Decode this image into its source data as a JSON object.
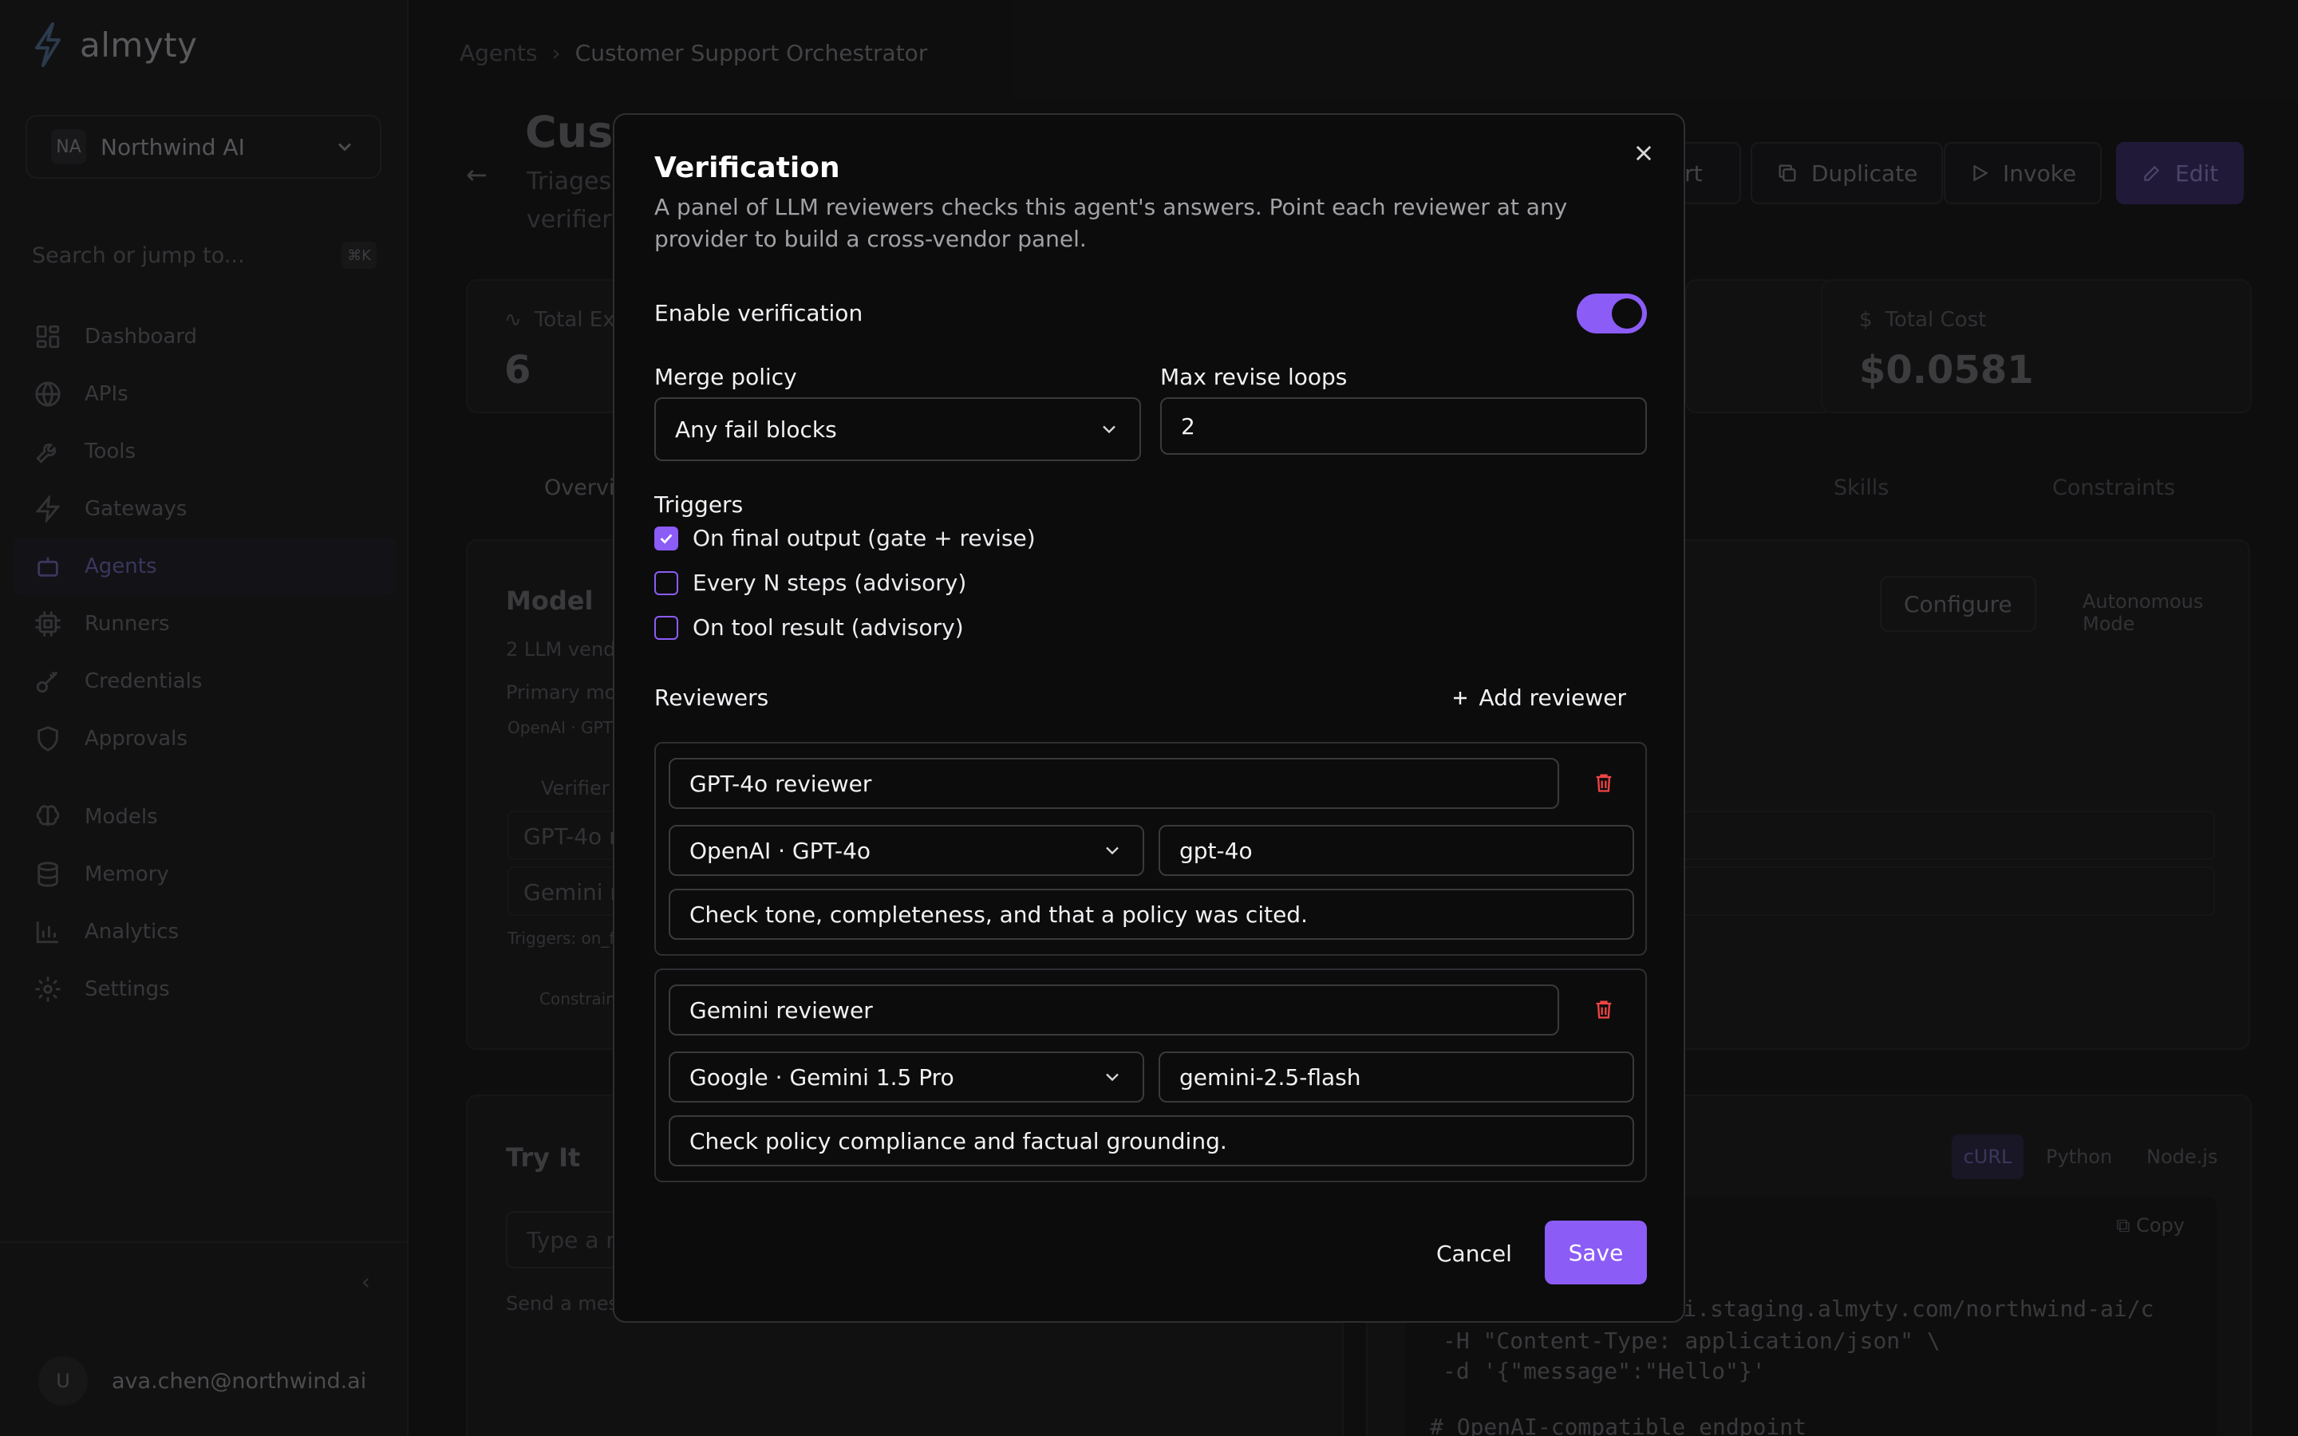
{
  "app": {
    "name": "almyty"
  },
  "sidebar": {
    "org_initials": "NA",
    "org_name": "Northwind AI",
    "search_placeholder": "Search or jump to...",
    "search_shortcut": "⌘K",
    "items": [
      {
        "label": "Dashboard",
        "icon": "grid-icon"
      },
      {
        "label": "APIs",
        "icon": "globe-icon"
      },
      {
        "label": "Tools",
        "icon": "wrench-icon"
      },
      {
        "label": "Gateways",
        "icon": "bolt-icon"
      },
      {
        "label": "Agents",
        "icon": "bot-icon"
      },
      {
        "label": "Runners",
        "icon": "cpu-icon"
      },
      {
        "label": "Credentials",
        "icon": "key-icon"
      },
      {
        "label": "Approvals",
        "icon": "shield-icon"
      }
    ],
    "items2": [
      {
        "label": "Models",
        "icon": "brain-icon"
      },
      {
        "label": "Memory",
        "icon": "database-icon"
      },
      {
        "label": "Analytics",
        "icon": "bar-chart-icon"
      },
      {
        "label": "Settings",
        "icon": "gear-icon"
      }
    ],
    "user_initial": "U",
    "user_email": "ava.chen@northwind.ai"
  },
  "main": {
    "breadcrumb_root": "Agents",
    "breadcrumb_current": "Customer Support Orchestrator",
    "title": "Cust",
    "desc_line1": "Triages",
    "desc_line2": "verifier",
    "btn_export": "ort",
    "btn_duplicate": "Duplicate",
    "btn_invoke": "Invoke",
    "btn_edit": "Edit",
    "stat1_label": "Total Ex",
    "stat1_value": "6",
    "stat2_label": "Total Cost",
    "stat2_value": "$0.0581",
    "tab_overview": "Overvi",
    "tab_skills": "Skills",
    "tab_constraints": "Constraints",
    "model_title": "Model",
    "model_sub": "2 LLM vendo",
    "primary_model": "Primary mod",
    "model_chip": "OpenAI · GPT",
    "verifier_label": "Verifier p",
    "verifier_row1": "GPT-4o re",
    "verifier_row2": "Gemini re",
    "triggers_note": "Triggers: on_fi",
    "constraints_chip": "Constrain",
    "configure": "Configure",
    "autonomous": "Autonomous Mode",
    "try_title": "Try It",
    "try_placeholder": "Type a m",
    "try_hint": "Send a mess",
    "code_tabs": [
      "cURL",
      "Python",
      "Node.js"
    ],
    "copy": "Copy",
    "code_line1": "//api.staging.almyty.com/northwind-ai/c",
    "code_line2": "-H \"Content-Type: application/json\" \\",
    "code_line3": "-d '{\"message\":\"Hello\"}'",
    "code_line4": "# OpenAI-compatible endpoint"
  },
  "modal": {
    "title": "Verification",
    "description": "A panel of LLM reviewers checks this agent's answers. Point each reviewer at any provider to build a cross-vendor panel.",
    "enable_label": "Enable verification",
    "enabled": true,
    "merge_label": "Merge policy",
    "merge_value": "Any fail blocks",
    "max_loops_label": "Max revise loops",
    "max_loops_value": "2",
    "triggers_label": "Triggers",
    "triggers": [
      {
        "label": "On final output (gate + revise)",
        "checked": true
      },
      {
        "label": "Every N steps (advisory)",
        "checked": false
      },
      {
        "label": "On tool result (advisory)",
        "checked": false
      }
    ],
    "reviewers_label": "Reviewers",
    "add_reviewer": "Add reviewer",
    "reviewers": [
      {
        "name": "GPT-4o reviewer",
        "provider": "OpenAI · GPT-4o",
        "model": "gpt-4o",
        "instructions": "Check tone, completeness, and that a policy was cited."
      },
      {
        "name": "Gemini reviewer",
        "provider": "Google · Gemini 1.5 Pro",
        "model": "gemini-2.5-flash",
        "instructions": "Check policy compliance and factual grounding."
      }
    ],
    "cancel": "Cancel",
    "save": "Save"
  },
  "colors": {
    "accent": "#8b5cf6",
    "danger": "#ef4444",
    "modal_bg": "#0c0c0d"
  }
}
